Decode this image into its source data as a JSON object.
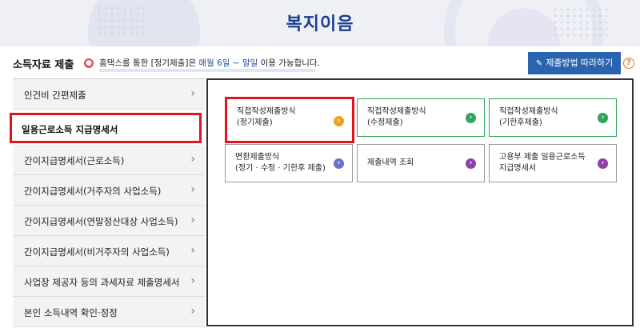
{
  "banner": {
    "title": "복지이음"
  },
  "info": {
    "section_title": "소득자료 제출",
    "notice_prefix": "홈택스를 통한 [정기제출]은 ",
    "notice_highlight": "매월 6일 ~ 말일",
    "notice_suffix": " 이용 가능합니다.",
    "guide_button": "제출방법 따라하기",
    "help": "?"
  },
  "sidebar": {
    "items": [
      {
        "label": "인건비 간편제출"
      },
      {
        "label": "일용근로소득 지급명세서",
        "active": true
      },
      {
        "label": "간이지급명세서(근로소득)"
      },
      {
        "label": "간이지급명세서(거주자의 사업소득)"
      },
      {
        "label": "간이지급명세서(연말정산대상 사업소득)"
      },
      {
        "label": "간이지급명세서(비거주자의 사업소득)"
      },
      {
        "label": "사업장 제공자 등의 과세자료 제출명세서"
      },
      {
        "label": "본인 소득내역 확인·정정"
      }
    ],
    "chevron": "›"
  },
  "cards": [
    {
      "line1": "직접작성제출방식",
      "line2": "(정기제출)",
      "color": "#f0a020"
    },
    {
      "line1": "직접작성제출방식",
      "line2": "(수정제출)",
      "color": "#2fa45a"
    },
    {
      "line1": "직접작성제출방식",
      "line2": "(기한후제출)",
      "color": "#2fa45a"
    },
    {
      "line1": "변환제출방식",
      "line2": "(정기 · 수정 · 기한후 제출)",
      "color": "#6c6fc9"
    },
    {
      "line1": "제출내역 조회",
      "line2": "",
      "color": "#8e3fa8"
    },
    {
      "line1": "고용부 제출 일용근로소득",
      "line2": "지급명세서",
      "color": "#8e3fa8"
    }
  ],
  "colors": {
    "accent": "#2a64b0",
    "highlight": "#e3121c",
    "title": "#1a3d8f"
  }
}
